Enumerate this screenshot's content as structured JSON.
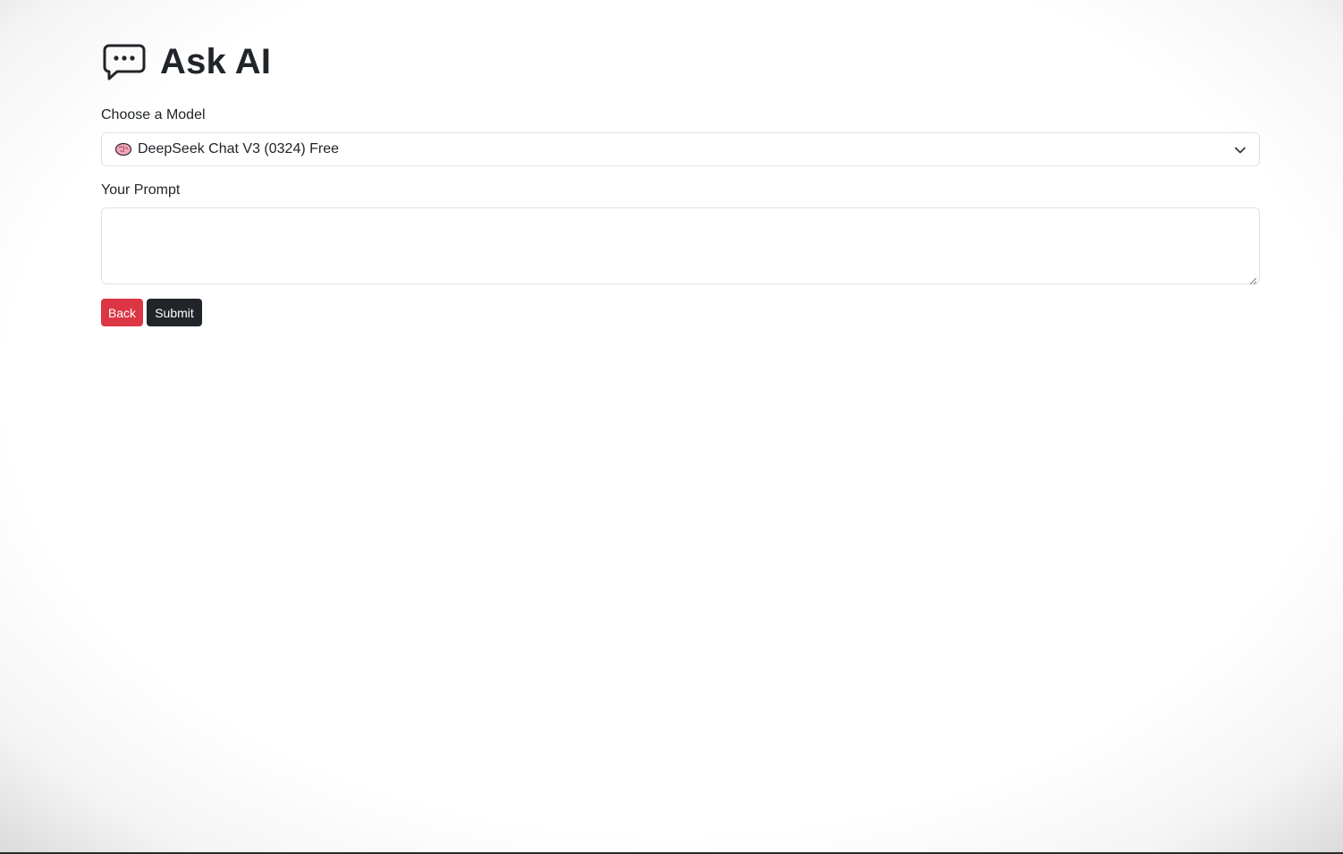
{
  "header": {
    "title": "Ask AI",
    "icon": "chat-dots-icon"
  },
  "model": {
    "label": "Choose a Model",
    "selected_icon": "brain-icon",
    "selected": "DeepSeek Chat V3 (0324) Free"
  },
  "prompt": {
    "label": "Your Prompt",
    "value": ""
  },
  "buttons": {
    "back_label": "Back",
    "submit_label": "Submit",
    "back_color": "#dc3545",
    "submit_color": "#212529"
  }
}
